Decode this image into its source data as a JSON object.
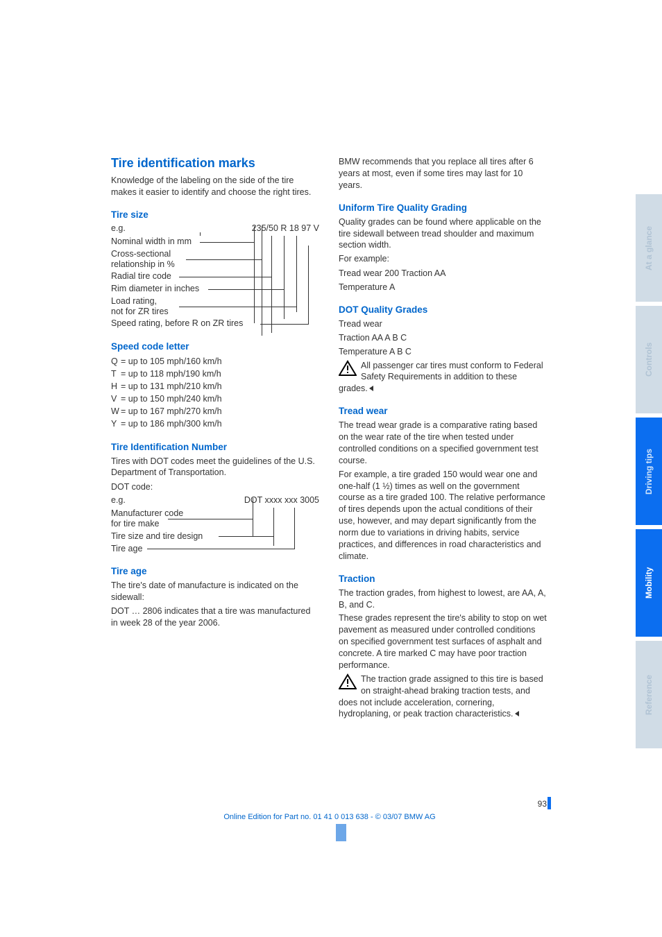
{
  "col1": {
    "main_heading": "Tire identification marks",
    "intro": "Knowledge of the labeling on the side of the tire makes it easier to identify and choose the right tires.",
    "tire_size": {
      "heading": "Tire size",
      "eg_label": "e.g.",
      "eg_value": "235/50 R 18 97 V",
      "rows": [
        "Nominal width in mm",
        "Cross-sectional\nrelationship in %",
        "Radial tire code",
        "Rim diameter in inches",
        "Load rating,\nnot for ZR tires",
        "Speed rating, before R on ZR tires"
      ]
    },
    "speed_code": {
      "heading": "Speed code letter",
      "items": [
        {
          "l": "Q",
          "t": "= up to 105 mph/160 km/h"
        },
        {
          "l": "T",
          "t": "= up to 118 mph/190 km/h"
        },
        {
          "l": "H",
          "t": "= up to 131 mph/210 km/h"
        },
        {
          "l": "V",
          "t": "= up to 150 mph/240 km/h"
        },
        {
          "l": "W",
          "t": "= up to 167 mph/270 km/h"
        },
        {
          "l": "Y",
          "t": "= up to 186 mph/300 km/h"
        }
      ]
    },
    "tin": {
      "heading": "Tire Identification Number",
      "p1": "Tires with DOT codes meet the guidelines of the U.S. Department of Transportation.",
      "p2": "DOT code:",
      "eg_label": "e.g.",
      "eg_value": "DOT xxxx xxx 3005",
      "rows": [
        "Manufacturer code\nfor tire make",
        "Tire size and tire design",
        "Tire age"
      ]
    },
    "tire_age": {
      "heading": "Tire age",
      "p1": "The tire's date of manufacture is indicated on the sidewall:",
      "p2": "DOT … 2806 indicates that a tire was manufactured in week 28 of the year 2006."
    }
  },
  "col2": {
    "bmw_rec": "BMW recommends that you replace all tires after 6 years at most, even if some tires may last for 10 years.",
    "utqg": {
      "heading": "Uniform Tire Quality Grading",
      "p1": "Quality grades can be found where applicable on the tire sidewall between tread shoulder and maximum section width.",
      "p2": "For example:",
      "p3": "Tread wear 200 Traction AA",
      "p4": "Temperature A"
    },
    "dot": {
      "heading": "DOT Quality Grades",
      "p1": "Tread wear",
      "p2": "Traction AA A B C",
      "p3": "Temperature A B C",
      "note": "All passenger car tires must conform to Federal Safety Requirements in addition to these grades."
    },
    "tread": {
      "heading": "Tread wear",
      "p1": "The tread wear grade is a comparative rating based on the wear rate of the tire when tested under controlled conditions on a specified government test course.",
      "p2": "For example, a tire graded 150 would wear one and one-half (1 ½) times as well on the government course as a tire graded 100. The relative performance of tires depends upon the actual conditions of their use, however, and may depart significantly from the norm due to variations in driving habits, service practices, and differences in road characteristics and climate."
    },
    "traction": {
      "heading": "Traction",
      "p1": "The traction grades, from highest to lowest, are AA, A, B, and C.",
      "p2": "These grades represent the tire's ability to stop on wet pavement as measured under controlled conditions on specified government test surfaces of asphalt and concrete. A tire marked C may have poor traction performance.",
      "note": "The traction grade assigned to this tire is based on straight-ahead braking traction tests, and does not include acceleration, cornering, hydroplaning, or peak traction characteristics."
    }
  },
  "tabs": [
    "At a glance",
    "Controls",
    "Driving tips",
    "Mobility",
    "Reference"
  ],
  "page_number": "93",
  "footer": "Online Edition for Part no. 01 41 0 013 638 - © 03/07 BMW AG"
}
